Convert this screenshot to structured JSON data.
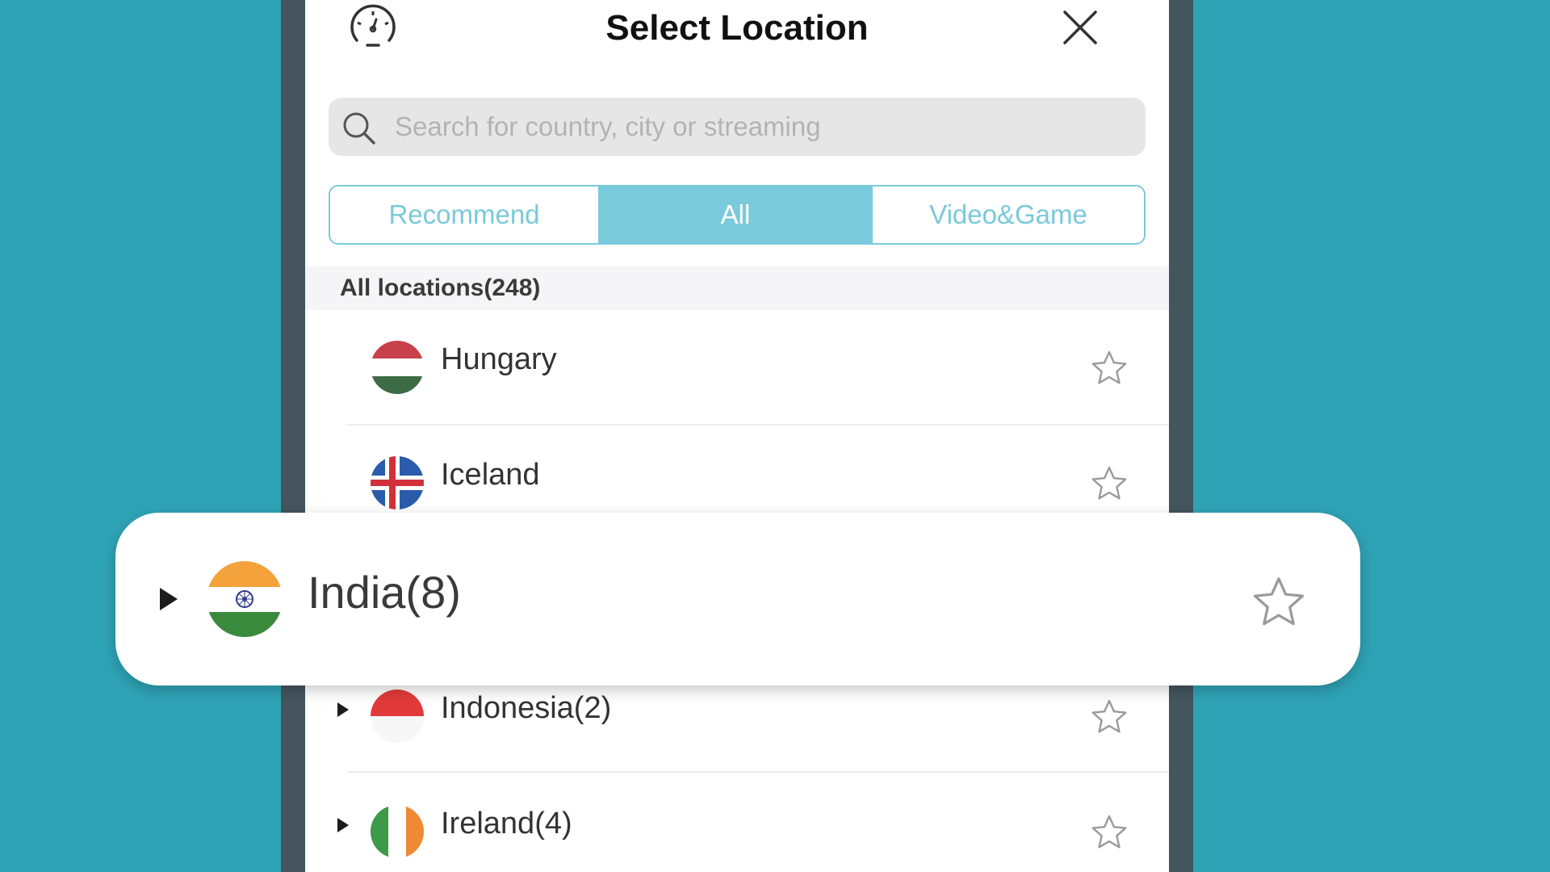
{
  "header": {
    "title": "Select Location"
  },
  "search": {
    "placeholder": "Search for country, city or streaming",
    "value": ""
  },
  "tabs": [
    {
      "label": "Recommend",
      "active": false
    },
    {
      "label": "All",
      "active": true
    },
    {
      "label": "Video&Game",
      "active": false
    }
  ],
  "list": {
    "section_label": "All locations(248)",
    "rows": [
      {
        "name": "Hungary",
        "expandable": false,
        "flag": "hungary-flag"
      },
      {
        "name": "Iceland",
        "expandable": false,
        "flag": "iceland-flag"
      },
      {
        "name": "Indonesia(2)",
        "expandable": true,
        "flag": "indonesia-flag"
      },
      {
        "name": "Ireland(4)",
        "expandable": true,
        "flag": "ireland-flag"
      }
    ]
  },
  "highlight": {
    "name": "India(8)",
    "expandable": true,
    "flag": "india-flag"
  },
  "colors": {
    "background": "#2fa3b6",
    "accent": "#79cadb",
    "frame": "#44555e"
  }
}
